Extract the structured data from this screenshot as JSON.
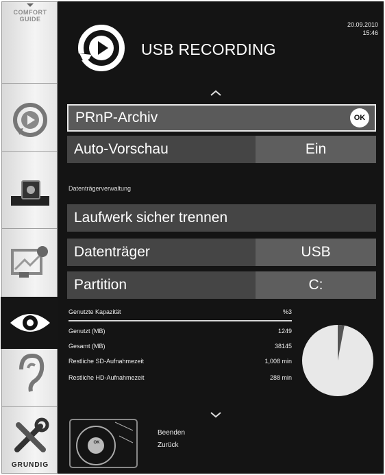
{
  "sidebar": {
    "comfort_guide": "COMFORT GUIDE",
    "brand": "GRUNDIG",
    "items": [
      {
        "icon": "record-icon"
      },
      {
        "icon": "usb-device-icon"
      },
      {
        "icon": "network-icon"
      },
      {
        "icon": "eye-icon"
      },
      {
        "icon": "ear-icon"
      },
      {
        "icon": "tools-icon"
      }
    ]
  },
  "header": {
    "title": "USB RECORDING",
    "date": "20.09.2010",
    "time": "15:46"
  },
  "menu": {
    "prnp_archive": {
      "label": "PRnP-Archiv",
      "ok": "OK"
    },
    "auto_preview": {
      "label": "Auto-Vorschau",
      "value": "Ein"
    },
    "section_title": "Datenträgerverwaltung",
    "safe_remove": {
      "label": "Laufwerk sicher trennen"
    },
    "disk": {
      "label": "Datenträger",
      "value": "USB"
    },
    "partition": {
      "label": "Partition",
      "value": "C:"
    }
  },
  "capacity": {
    "title_label": "Genutzte Kapazität",
    "title_value": "%3",
    "rows": [
      {
        "label": "Genutzt (MB)",
        "value": "1249"
      },
      {
        "label": "Gesamt (MB)",
        "value": "38145"
      },
      {
        "label": "Restliche SD-Aufnahmezeit",
        "value": "1,008 min"
      },
      {
        "label": "Restliche HD-Aufnahmezeit",
        "value": "288 min"
      }
    ],
    "used_fraction": 0.03
  },
  "footer": {
    "remote_ok": "OK",
    "exit": "Beenden",
    "back": "Zurück"
  },
  "colors": {
    "panel": "#141414",
    "row": "#454545",
    "value_cell": "#5e5e5e",
    "pie_free": "#e8e8e8",
    "pie_used": "#555555"
  }
}
